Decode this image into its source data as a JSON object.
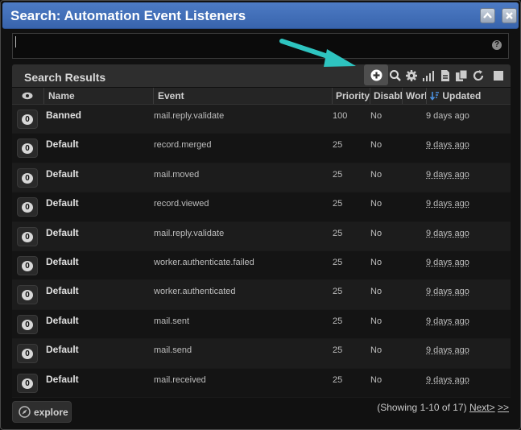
{
  "window": {
    "title": "Search: Automation Event Listeners"
  },
  "titlebar_buttons": [
    {
      "icon": "chevron-up-icon"
    },
    {
      "icon": "close-icon"
    }
  ],
  "search": {
    "value": "",
    "placeholder": "",
    "help_icon": "help-icon"
  },
  "results": {
    "label": "Search Results",
    "toolbar": [
      "add-icon",
      "search-icon",
      "gear-icon",
      "chart-icon",
      "export-icon",
      "copy-icon",
      "refresh-icon",
      "select-icon"
    ],
    "columns": {
      "watch": "",
      "name": "Name",
      "event": "Event",
      "priority": "Priority",
      "disabled": "Disabled",
      "worker": "Worker",
      "updated": "Updated"
    },
    "rows": [
      {
        "watchers": "0",
        "name": "Banned",
        "event": "mail.reply.validate",
        "priority": "100",
        "disabled": "No",
        "updated": "9 days ago"
      },
      {
        "watchers": "0",
        "name": "Default",
        "event": "record.merged",
        "priority": "25",
        "disabled": "No",
        "updated": "9 days ago"
      },
      {
        "watchers": "0",
        "name": "Default",
        "event": "mail.moved",
        "priority": "25",
        "disabled": "No",
        "updated": "9 days ago"
      },
      {
        "watchers": "0",
        "name": "Default",
        "event": "record.viewed",
        "priority": "25",
        "disabled": "No",
        "updated": "9 days ago"
      },
      {
        "watchers": "0",
        "name": "Default",
        "event": "mail.reply.validate",
        "priority": "25",
        "disabled": "No",
        "updated": "9 days ago"
      },
      {
        "watchers": "0",
        "name": "Default",
        "event": "worker.authenticate.failed",
        "priority": "25",
        "disabled": "No",
        "updated": "9 days ago"
      },
      {
        "watchers": "0",
        "name": "Default",
        "event": "worker.authenticated",
        "priority": "25",
        "disabled": "No",
        "updated": "9 days ago"
      },
      {
        "watchers": "0",
        "name": "Default",
        "event": "mail.sent",
        "priority": "25",
        "disabled": "No",
        "updated": "9 days ago"
      },
      {
        "watchers": "0",
        "name": "Default",
        "event": "mail.send",
        "priority": "25",
        "disabled": "No",
        "updated": "9 days ago"
      },
      {
        "watchers": "0",
        "name": "Default",
        "event": "mail.received",
        "priority": "25",
        "disabled": "No",
        "updated": "9 days ago"
      }
    ]
  },
  "footer": {
    "explore_label": "explore",
    "showing": "(Showing 1-10 of 17)",
    "next": "Next>",
    "last": ">>"
  },
  "colors": {
    "titlebar": "#3f6fb8",
    "arrow": "#2ec4c0",
    "background": "#111111"
  }
}
